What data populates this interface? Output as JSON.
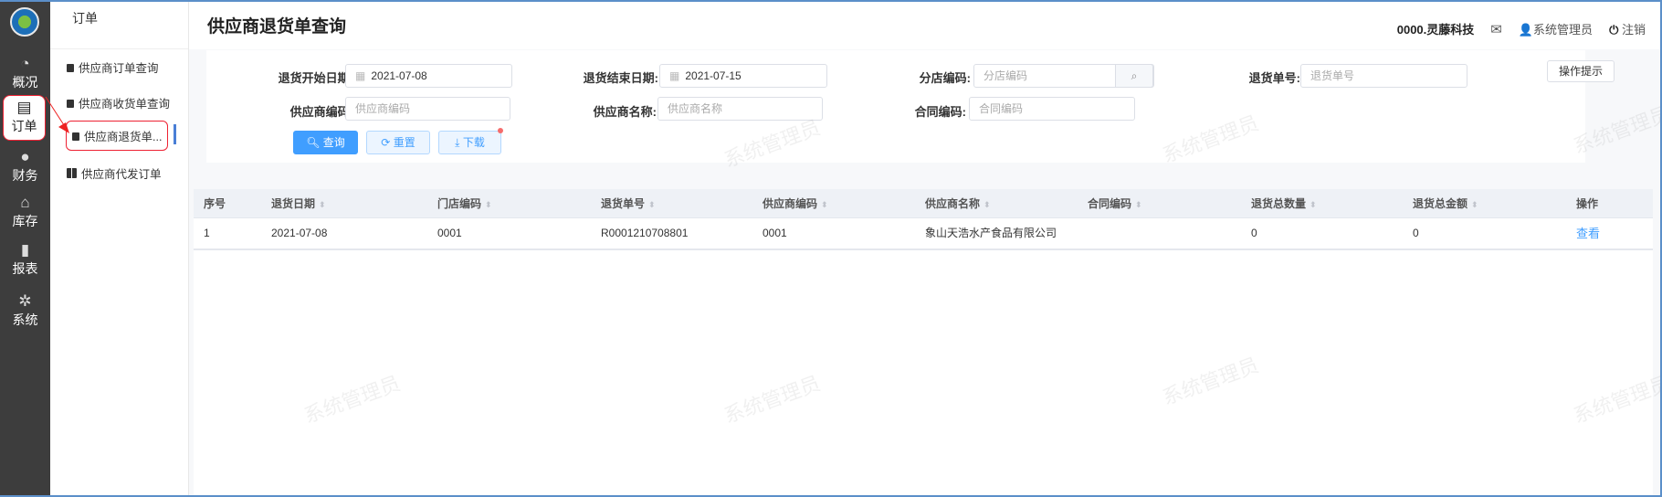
{
  "sidebar": {
    "items": [
      {
        "label": "概况",
        "icon": "dashboard-icon"
      },
      {
        "label": "订单",
        "icon": "clipboard-icon"
      },
      {
        "label": "财务",
        "icon": "finance-icon"
      },
      {
        "label": "库存",
        "icon": "warehouse-icon"
      },
      {
        "label": "报表",
        "icon": "bar-chart-icon"
      },
      {
        "label": "系统",
        "icon": "gear-icon"
      }
    ]
  },
  "submenu": {
    "title": "订单",
    "items": [
      "供应商订单查询",
      "供应商收货单查询",
      "供应商退货单...",
      "供应商代发订单"
    ]
  },
  "header": {
    "title": "供应商退货单查询",
    "company": "0000.灵藤科技",
    "user": "系统管理员",
    "logout": "注销"
  },
  "filters": {
    "start_date_label": "退货开始日期:",
    "start_date": "2021-07-08",
    "end_date_label": "退货结束日期:",
    "end_date": "2021-07-15",
    "store_label": "分店编码:",
    "store_placeholder": "分店编码",
    "return_no_label": "退货单号:",
    "return_no_placeholder": "退货单号",
    "supplier_code_label": "供应商编码:",
    "supplier_code_placeholder": "供应商编码",
    "supplier_name_label": "供应商名称:",
    "supplier_name_placeholder": "供应商名称",
    "contract_label": "合同编码:",
    "contract_placeholder": "合同编码",
    "query": "查询",
    "reset": "重置",
    "download": "下载",
    "tips": "操作提示"
  },
  "table": {
    "headers": [
      "序号",
      "退货日期",
      "门店编码",
      "退货单号",
      "供应商编码",
      "供应商名称",
      "合同编码",
      "退货总数量",
      "退货总金额",
      "操作"
    ],
    "rows": [
      [
        "1",
        "2021-07-08",
        "0001",
        "R0001210708801",
        "0001",
        "象山天浩水产食品有限公司",
        "",
        "0",
        "0",
        "查看"
      ]
    ]
  },
  "watermark": "系统管理员",
  "colors": {
    "accent": "#409eff",
    "sidebar": "#3d3d3d",
    "highlight": "#e22233"
  }
}
